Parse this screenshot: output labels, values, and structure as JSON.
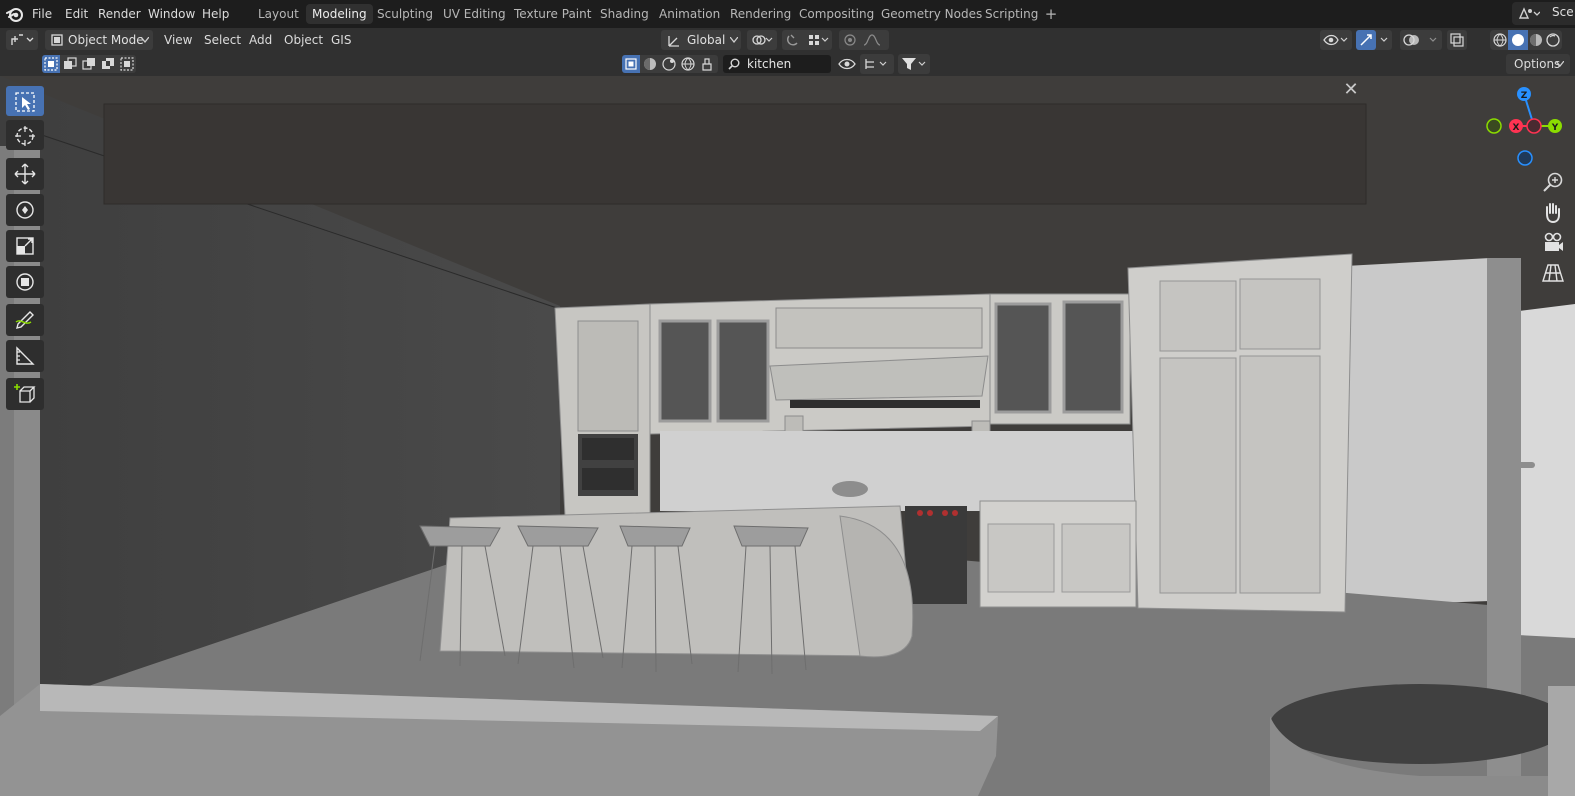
{
  "menu": {
    "file": "File",
    "edit": "Edit",
    "render": "Render",
    "window": "Window",
    "help": "Help"
  },
  "workspaces": [
    {
      "label": "Layout"
    },
    {
      "label": "Modeling",
      "active": true
    },
    {
      "label": "Sculpting"
    },
    {
      "label": "UV Editing"
    },
    {
      "label": "Texture Paint"
    },
    {
      "label": "Shading"
    },
    {
      "label": "Animation"
    },
    {
      "label": "Rendering"
    },
    {
      "label": "Compositing"
    },
    {
      "label": "Geometry Nodes"
    },
    {
      "label": "Scripting"
    }
  ],
  "workspace_add": "+",
  "scene": {
    "label": "Sce"
  },
  "header": {
    "mode": "Object Mode",
    "view": "View",
    "select": "Select",
    "add": "Add",
    "object": "Object",
    "gis": "GIS",
    "transform_orientation": "Global"
  },
  "outliner": {
    "search_value": "kitchen",
    "options": "Options"
  },
  "gizmo": {
    "z": "Z",
    "x": "X",
    "y": "Y"
  },
  "icons": {
    "logo": "blender-logo-icon",
    "close": "close-icon"
  },
  "colors": {
    "accent": "#4772b3",
    "axis_x": "#ff3352",
    "axis_y": "#8bdc00",
    "axis_z": "#2890ff",
    "background": "#3d3d3d"
  }
}
